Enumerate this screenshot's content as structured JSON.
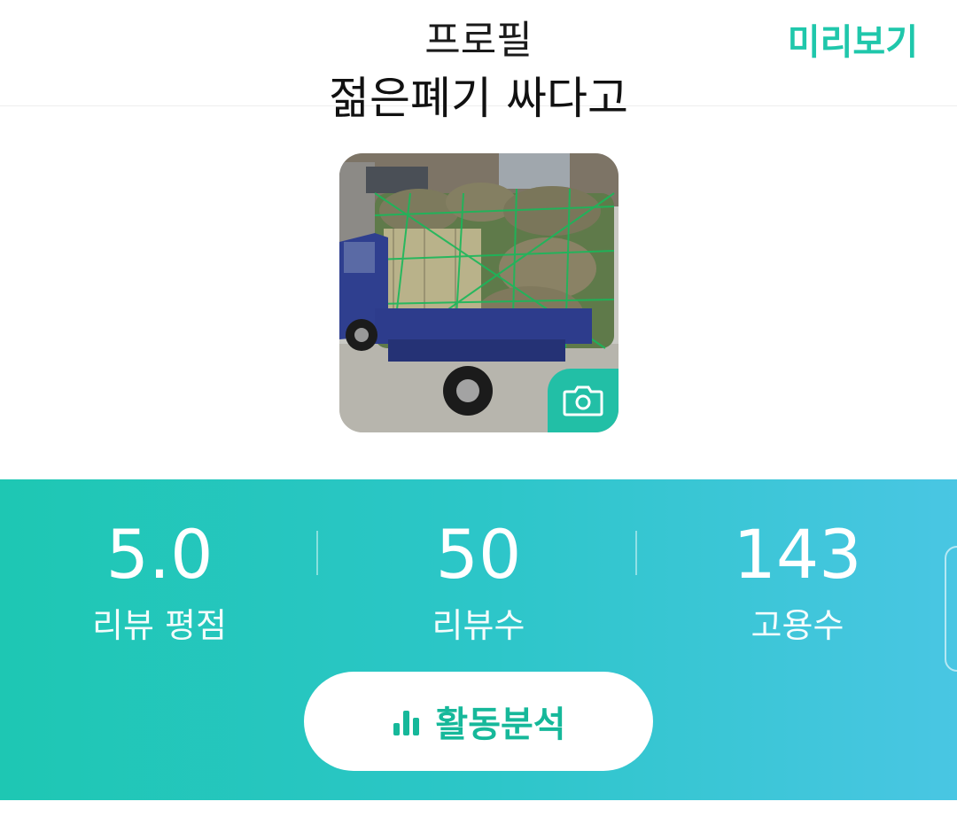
{
  "header": {
    "title": "프로필",
    "subtitle": "젊은폐기 싸다고",
    "preview_label": "미리보기"
  },
  "profile_photo": {
    "camera_icon": "camera-icon"
  },
  "stats": [
    {
      "value": "5.0",
      "label": "리뷰 평점"
    },
    {
      "value": "50",
      "label": "리뷰수"
    },
    {
      "value": "143",
      "label": "고용수"
    }
  ],
  "analysis_button": {
    "icon": "bar-chart-icon",
    "label": "활동분석"
  },
  "colors": {
    "accent": "#1fc7ab",
    "gradient_start": "#1ec7b3",
    "gradient_end": "#49c6e3"
  }
}
